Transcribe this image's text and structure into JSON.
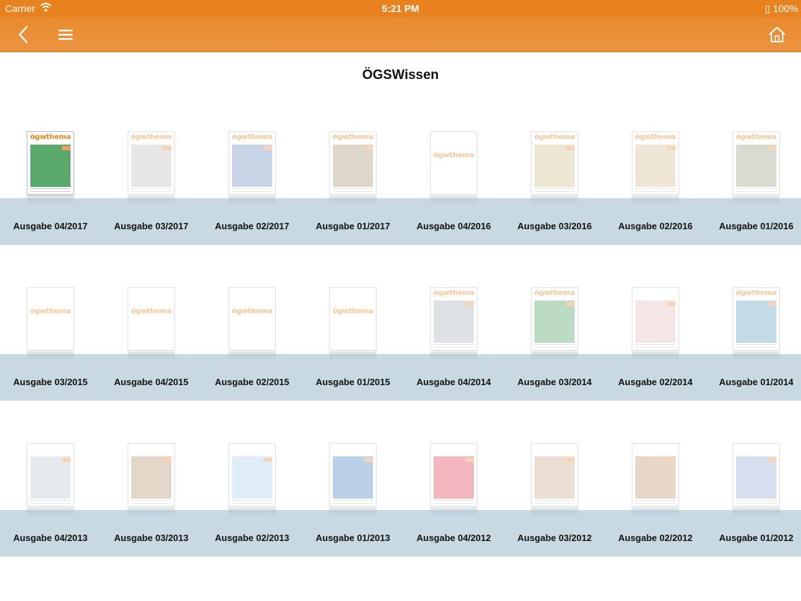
{
  "status_bar": {
    "carrier": "Carrier",
    "time": "5:21 PM",
    "battery": "100%"
  },
  "nav": {
    "back_icon": "chevron-left-icon",
    "menu_icon": "hamburger-menu-icon",
    "home_icon": "home-icon"
  },
  "page_title": "ÖGSWissen",
  "colors": {
    "accent": "#e8821f",
    "shelf": "#c9d9e2"
  },
  "rows": [
    {
      "issues": [
        {
          "label": "Ausgabe 04/2017",
          "brand": "ögwthema",
          "art": "#5aa86a",
          "faded": false
        },
        {
          "label": "Ausgabe 03/2017",
          "brand": "ögwthema",
          "art": "#c8c8c8",
          "faded": true
        },
        {
          "label": "Ausgabe 02/2017",
          "brand": "ögwthema",
          "art": "#8aa4c8",
          "faded": true
        },
        {
          "label": "Ausgabe 01/2017",
          "brand": "ögwthema",
          "art": "#b8a58a",
          "faded": true
        },
        {
          "label": "Ausgabe 04/2016",
          "brand": "ögwthema",
          "art": "#ffffff",
          "faded": true
        },
        {
          "label": "Ausgabe 03/2016",
          "brand": "ögwthema",
          "art": "#d8c8a0",
          "faded": true
        },
        {
          "label": "Ausgabe 02/2016",
          "brand": "ögwthema",
          "art": "#dcc8a8",
          "faded": true
        },
        {
          "label": "Ausgabe 01/2016",
          "brand": "ögwthema",
          "art": "#a8b098",
          "faded": true
        }
      ]
    },
    {
      "issues": [
        {
          "label": "Ausgabe 03/2015",
          "brand": "ögwthema",
          "art": "#ffffff",
          "faded": true
        },
        {
          "label": "Ausgabe 04/2015",
          "brand": "ögwthema",
          "art": "#ffffff",
          "faded": true
        },
        {
          "label": "Ausgabe 02/2015",
          "brand": "ögwthema",
          "art": "#ffffff",
          "faded": true
        },
        {
          "label": "Ausgabe 01/2015",
          "brand": "ögwthema",
          "art": "#ffffff",
          "faded": true
        },
        {
          "label": "Ausgabe 04/2014",
          "brand": "ögwthema",
          "art": "#b8c0c8",
          "faded": true
        },
        {
          "label": "Ausgabe 03/2014",
          "brand": "ögwthema",
          "art": "#6ab07a",
          "faded": true
        },
        {
          "label": "Ausgabe 02/2014",
          "brand": "",
          "art": "#e8c8c8",
          "faded": true
        },
        {
          "label": "Ausgabe 01/2014",
          "brand": "ögwthema",
          "art": "#7ab0d0",
          "faded": true
        }
      ]
    },
    {
      "issues": [
        {
          "label": "Ausgabe 04/2013",
          "brand": "",
          "art": "#c8d0d8",
          "faded": true
        },
        {
          "label": "Ausgabe 03/2013",
          "brand": "",
          "art": "#c0a888",
          "faded": true
        },
        {
          "label": "Ausgabe 02/2013",
          "brand": "",
          "art": "#b8d8f0",
          "faded": true
        },
        {
          "label": "Ausgabe 01/2013",
          "brand": "",
          "art": "#6a9ad0",
          "faded": true
        },
        {
          "label": "Ausgabe 04/2012",
          "brand": "",
          "art": "#e86070",
          "faded": true
        },
        {
          "label": "Ausgabe 03/2012",
          "brand": "",
          "art": "#d8b8a0",
          "faded": true
        },
        {
          "label": "Ausgabe 02/2012",
          "brand": "",
          "art": "#c8a888",
          "faded": true
        },
        {
          "label": "Ausgabe 01/2012",
          "brand": "",
          "art": "#a8b8d8",
          "faded": true
        }
      ]
    }
  ]
}
